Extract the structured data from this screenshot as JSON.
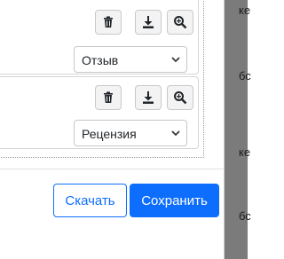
{
  "background_peek": [
    "ке",
    "бс",
    "ке",
    "бс"
  ],
  "cards": [
    {
      "select_value": "Отзыв",
      "icons": [
        "trash-icon",
        "download-icon",
        "zoom-in-icon"
      ]
    },
    {
      "select_value": "Рецензия",
      "icons": [
        "trash-icon",
        "download-icon",
        "zoom-in-icon"
      ]
    }
  ],
  "footer": {
    "download_label": "Скачать",
    "save_label": "Сохранить"
  },
  "colors": {
    "primary": "#0d6efd",
    "backdrop": "#7b7b7b"
  }
}
